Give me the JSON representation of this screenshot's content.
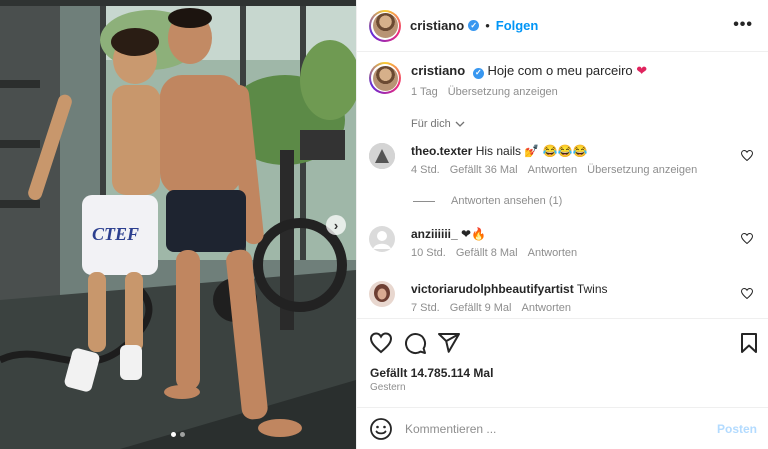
{
  "header": {
    "username": "cristiano",
    "separator": "•",
    "follow_label": "Folgen",
    "more_label": "•••"
  },
  "caption": {
    "username": "cristiano",
    "text": "Hoje com o meu parceiro",
    "emoji": "❤",
    "age": "1 Tag",
    "translate_label": "Übersetzung anzeigen"
  },
  "for_you_label": "Für dich",
  "comments": [
    {
      "username": "theo.texter",
      "text": "His nails 💅 😂😂😂",
      "age": "4 Std.",
      "likes": "Gefällt 36 Mal",
      "reply_label": "Antworten",
      "translate_label": "Übersetzung anzeigen",
      "avatar_color": "#c9c9c9"
    },
    {
      "username": "anziiiiii_",
      "text": "❤🔥",
      "age": "10 Std.",
      "likes": "Gefällt 8 Mal",
      "reply_label": "Antworten",
      "avatar_color": "#dbdbdb"
    },
    {
      "username": "victoriarudolphbeautifyartist",
      "text": "Twins",
      "age": "7 Std.",
      "likes": "Gefällt 9 Mal",
      "reply_label": "Antworten",
      "avatar_color": "#7a4a3e"
    }
  ],
  "replies_label": "Antworten ansehen (1)",
  "likes_total": "Gefällt 14.785.114 Mal",
  "posted_date": "Gestern",
  "composer": {
    "placeholder": "Kommentieren ...",
    "post_label": "Posten"
  },
  "carousel": {
    "current": 1,
    "total": 2
  },
  "colors": {
    "accent": "#0095f6",
    "verified": "#3897f0",
    "heart": "#e0245e",
    "muted": "#8e8e8e"
  }
}
